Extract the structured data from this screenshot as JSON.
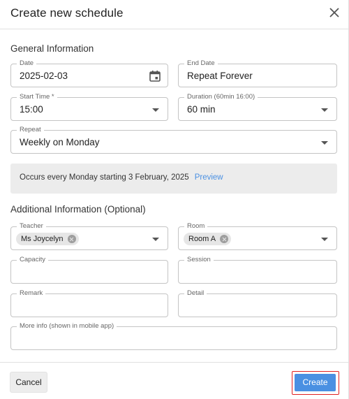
{
  "dialog": {
    "title": "Create new schedule",
    "close_icon": "close-icon"
  },
  "general": {
    "title": "General Information",
    "date": {
      "label": "Date",
      "value": "2025-02-03",
      "icon": "calendar-icon"
    },
    "end_date": {
      "label": "End Date",
      "value": "Repeat Forever"
    },
    "start_time": {
      "label": "Start Time *",
      "value": "15:00"
    },
    "duration": {
      "label": "Duration (60min 16:00)",
      "value": "60 min"
    },
    "repeat": {
      "label": "Repeat",
      "value": "Weekly on Monday"
    },
    "occurs_text": "Occurs every Monday starting 3 February, 2025",
    "preview_label": "Preview"
  },
  "additional": {
    "title": "Additional Information (Optional)",
    "teacher": {
      "label": "Teacher",
      "chip": "Ms Joycelyn"
    },
    "room": {
      "label": "Room",
      "chip": "Room A"
    },
    "capacity": {
      "label": "Capacity",
      "value": ""
    },
    "session": {
      "label": "Session",
      "value": ""
    },
    "remark": {
      "label": "Remark",
      "value": ""
    },
    "detail": {
      "label": "Detail",
      "value": ""
    },
    "more_info": {
      "label": "More info (shown in mobile app)",
      "value": ""
    }
  },
  "footer": {
    "cancel_label": "Cancel",
    "create_label": "Create"
  },
  "colors": {
    "accent": "#4a90e2",
    "highlight_outline": "#e02020"
  }
}
